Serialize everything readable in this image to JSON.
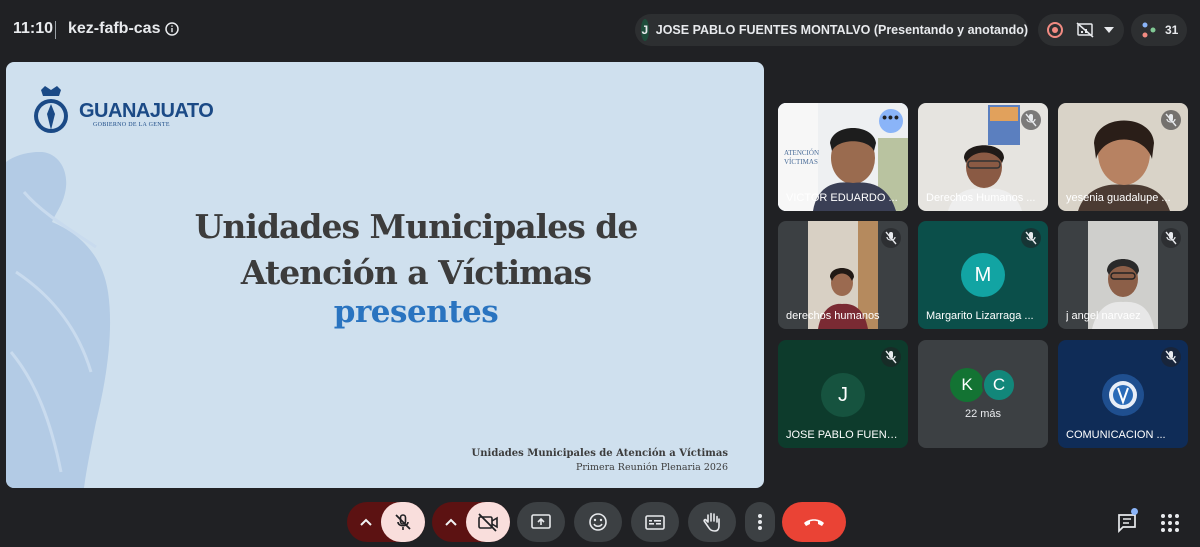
{
  "header": {
    "time": "11:10",
    "meeting_code": "kez-fafb-cas",
    "presenter_initial": "J",
    "presenter_text": "JOSE PABLO FUENTES MONTALVO (Presentando y anotando)",
    "participant_count": "31"
  },
  "slide": {
    "logo_text": "GUANAJUATO",
    "logo_subtext": "GOBIERNO DE LA GENTE",
    "title_line1": "Unidades Municipales de",
    "title_line2": "Atención a Víctimas",
    "title_accent": "presentes",
    "footer_line1": "Unidades Municipales de Atención a Víctimas",
    "footer_line2": "Primera Reunión Plenaria 2026"
  },
  "tiles": [
    {
      "name": "VICTOR EDUARDO ...",
      "type": "video"
    },
    {
      "name": "Derechos Humanos ...",
      "type": "video"
    },
    {
      "name": "yesenia guadalupe ...",
      "type": "video"
    },
    {
      "name": "derechos humanos",
      "type": "video"
    },
    {
      "name": "Margarito Lizarraga ...",
      "initial": "M",
      "type": "avatar"
    },
    {
      "name": "j angel narvaez",
      "type": "video"
    },
    {
      "name": "JOSE PABLO FUENTES ...",
      "initial": "J",
      "type": "avatar"
    },
    {
      "initials": [
        "K",
        "C"
      ],
      "more_label": "22 más",
      "type": "others"
    },
    {
      "name": "COMUNICACION ...",
      "type": "logo"
    }
  ],
  "colors": {
    "background": "#202124",
    "accent": "#8ab4f8",
    "mic_off_red": "#f9dedc",
    "end_call": "#ea4335"
  },
  "controls": {
    "mic": "mic-off-icon",
    "camera": "camera-off-icon",
    "present": "present-screen-icon",
    "reactions": "emoji-icon",
    "captions": "captions-icon",
    "raise_hand": "raise-hand-icon",
    "more": "more-vert-icon",
    "end_call": "end-call-icon",
    "chat": "chat-icon",
    "activities": "apps-grid-icon"
  }
}
